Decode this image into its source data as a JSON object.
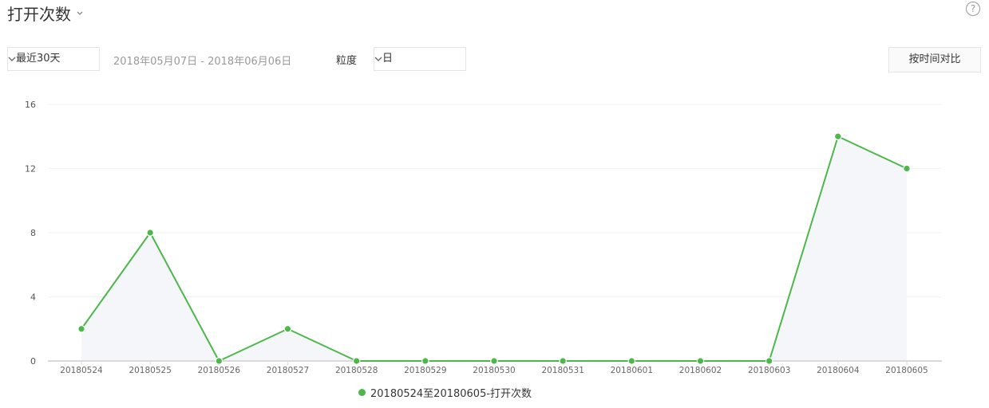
{
  "header": {
    "title": "打开次数"
  },
  "controls": {
    "range_select": "最近30天",
    "date_range": "2018年05月07日 - 2018年06月06日",
    "granularity_label": "粒度",
    "granularity_select": "日",
    "compare_button": "按时间对比",
    "help_icon_text": "?"
  },
  "colors": {
    "series": "#4cb84a",
    "area": "#f5f6f9",
    "axis": "#d9d9d9",
    "grid": "#f2f2f2"
  },
  "chart_data": {
    "type": "line",
    "categories": [
      "20180524",
      "20180525",
      "20180526",
      "20180527",
      "20180528",
      "20180529",
      "20180530",
      "20180531",
      "20180601",
      "20180602",
      "20180603",
      "20180604",
      "20180605"
    ],
    "series": [
      {
        "name": "20180524至20180605-打开次数",
        "values": [
          2,
          8,
          0,
          2,
          0,
          0,
          0,
          0,
          0,
          0,
          0,
          14,
          12
        ]
      }
    ],
    "ylim": [
      0,
      16
    ],
    "yticks": [
      "0",
      "4",
      "8",
      "12",
      "16"
    ],
    "grid": true,
    "legend_position": "bottom-center"
  }
}
